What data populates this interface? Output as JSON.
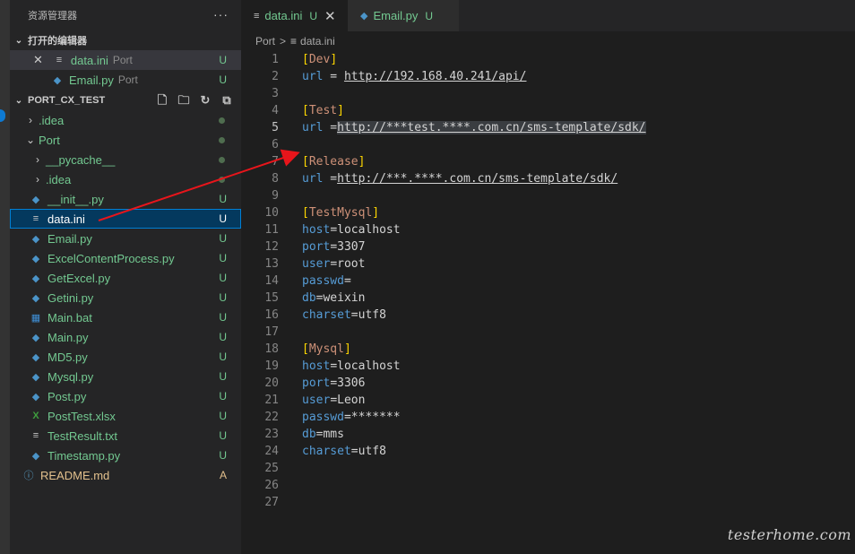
{
  "sidebar": {
    "title": "资源管理器",
    "more": "···",
    "open_editors_header": "打开的编辑器",
    "open_editors": [
      {
        "name": "data.ini",
        "desc": "Port",
        "status": "U",
        "icon": "ini-file-icon",
        "close": "✕"
      },
      {
        "name": "Email.py",
        "desc": "Port",
        "status": "U",
        "icon": "python-icon"
      }
    ],
    "project_header": "PORT_CX_TEST",
    "tree": [
      {
        "name": ".idea",
        "status": "dot"
      },
      {
        "name": "Port",
        "status": "dot"
      },
      {
        "name": "__pycache__",
        "status": "dot"
      },
      {
        "name": ".idea",
        "status": "dot"
      },
      {
        "name": "__init__.py",
        "status": "U"
      },
      {
        "name": "data.ini",
        "status": "U"
      },
      {
        "name": "Email.py",
        "status": "U"
      },
      {
        "name": "ExcelContentProcess.py",
        "status": "U"
      },
      {
        "name": "GetExcel.py",
        "status": "U"
      },
      {
        "name": "Getini.py",
        "status": "U"
      },
      {
        "name": "Main.bat",
        "status": "U"
      },
      {
        "name": "Main.py",
        "status": "U"
      },
      {
        "name": "MD5.py",
        "status": "U"
      },
      {
        "name": "Mysql.py",
        "status": "U"
      },
      {
        "name": "Post.py",
        "status": "U"
      },
      {
        "name": "PostTest.xlsx",
        "status": "U"
      },
      {
        "name": "TestResult.txt",
        "status": "U"
      },
      {
        "name": "Timestamp.py",
        "status": "U"
      },
      {
        "name": "README.md",
        "status": "A"
      }
    ]
  },
  "tabs": [
    {
      "label": "data.ini",
      "status": "U",
      "close": "✕"
    },
    {
      "label": "Email.py",
      "status": "U"
    }
  ],
  "breadcrumb": {
    "folder": "Port",
    "sep": ">",
    "file": "data.ini"
  },
  "code": {
    "lines": [
      "1",
      "2",
      "3",
      "4",
      "5",
      "6",
      "7",
      "8",
      "9",
      "10",
      "11",
      "12",
      "13",
      "14",
      "15",
      "16",
      "17",
      "18",
      "19",
      "20",
      "21",
      "22",
      "23",
      "24",
      "25",
      "26",
      "27"
    ],
    "dev_section": "Dev",
    "dev_url": "http://192.168.40.241/api/",
    "test_section": "Test",
    "test_url": "http://***test.****.com.cn/sms-template/sdk/",
    "release_section": "Release",
    "release_url": "http://***.****.com.cn/sms-template/sdk/",
    "testmysql_section": "TestMysql",
    "tm_host": "localhost",
    "tm_port": "3307",
    "tm_user": "root",
    "tm_passwd": "",
    "tm_db": "weixin",
    "tm_charset": "utf8",
    "mysql_section": "Mysql",
    "m_host": "localhost",
    "m_port": "3306",
    "m_user": "Leon",
    "m_passwd": "*******",
    "m_db": "mms",
    "m_charset": "utf8",
    "key_url": "url",
    "key_host": "host",
    "key_port": "port",
    "key_user": "user",
    "key_passwd": "passwd",
    "key_db": "db",
    "key_charset": "charset"
  },
  "watermark": "testerhome.com",
  "colors": {
    "accent": "#007fd4",
    "annotation_arrow": "#e8151b",
    "untracked": "#73c991"
  }
}
